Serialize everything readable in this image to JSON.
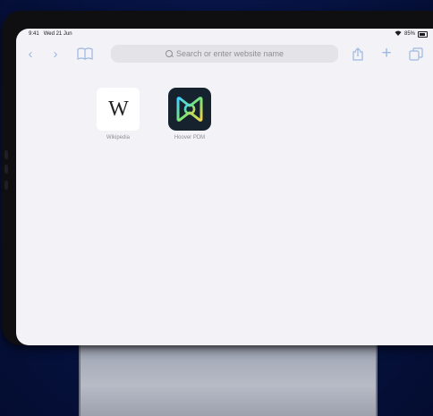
{
  "status_bar": {
    "time": "9:41",
    "date": "Wed 21 Jun",
    "battery": "85%"
  },
  "toolbar": {
    "address_placeholder": "Search or enter website name"
  },
  "favorites": [
    {
      "label": "Wikipedia",
      "glyph": "W",
      "icon": "wikipedia-logo"
    },
    {
      "label": "Hoover PDM",
      "icon": "hoover-logo"
    }
  ],
  "colors": {
    "accent": "#9fb8e0",
    "background": "#06123a",
    "screen": "#f2f2f7"
  }
}
